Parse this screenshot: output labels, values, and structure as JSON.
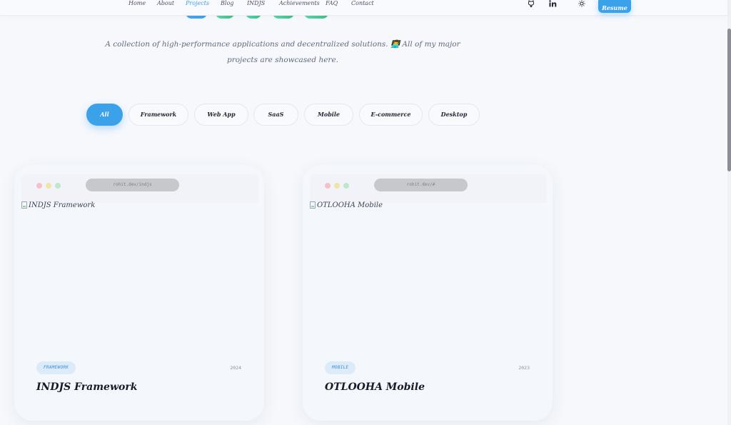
{
  "nav": {
    "links": [
      "Home",
      "About",
      "Projects",
      "Blog",
      "INDJS",
      "Achievements",
      "FAQ",
      "Contact"
    ],
    "active": "Projects",
    "icons": [
      "github-icon",
      "linkedin-icon",
      "sun-icon"
    ],
    "resume_label": "Resume"
  },
  "hero": {
    "subtitle": "A collection of high-performance applications and decentralized solutions. 👨‍💻 All of my major projects are showcased here."
  },
  "filters": {
    "items": [
      "All",
      "Framework",
      "Web App",
      "SaaS",
      "Mobile",
      "E-commerce",
      "Desktop"
    ],
    "active": "All"
  },
  "projects": [
    {
      "url": "rohit.dev/indjs",
      "image_alt": "INDJS Framework",
      "tag": "FRAMEWORK",
      "year": "2024",
      "title": "INDJS Framework"
    },
    {
      "url": "rohit.dev/#",
      "image_alt": "OTLOOHA Mobile",
      "tag": "MOBILE",
      "year": "2023",
      "title": "OTLOOHA Mobile"
    }
  ],
  "colors": {
    "accent": "#3ba2ea",
    "background": "#f6f8fc",
    "title_gradient": [
      "#5dd6b0",
      "#3fbf86"
    ]
  }
}
